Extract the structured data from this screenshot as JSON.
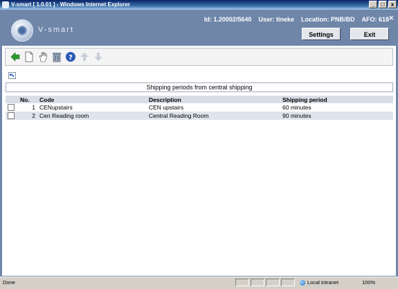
{
  "window": {
    "title": "V-smart [ 1.0.01 ] - Windows Internet Explorer"
  },
  "header": {
    "brand": "V-smart",
    "id_text": "Id: 1.20002/5640",
    "user_text": "User: tineke",
    "location_text": "Location: PNB/BD",
    "afo_text": "AFO: 618",
    "settings_label": "Settings",
    "exit_label": "Exit",
    "close_glyph": "✕"
  },
  "toolbar": {
    "icons": [
      "back-arrow-icon",
      "new-document-icon",
      "hand-select-icon",
      "delete-bin-icon",
      "help-icon",
      "move-up-icon",
      "move-down-icon"
    ]
  },
  "caption": "Shipping periods from central shipping",
  "table": {
    "headers": [
      "",
      "No.",
      "Code",
      "Description",
      "Shipping period"
    ],
    "rows": [
      {
        "no": "1",
        "code": "CENupstairs",
        "description": "CEN upstairs",
        "period": "60 minutes"
      },
      {
        "no": "2",
        "code": "Cen Reading room",
        "description": "Central Reading Room",
        "period": "90 minutes"
      }
    ]
  },
  "status": {
    "left": "Done",
    "zone": "Local intranet",
    "zoom": "100%"
  },
  "colors": {
    "accent": "#6f86a9",
    "header_row": "#d8dde6",
    "alt_row": "#dfe4ec"
  }
}
